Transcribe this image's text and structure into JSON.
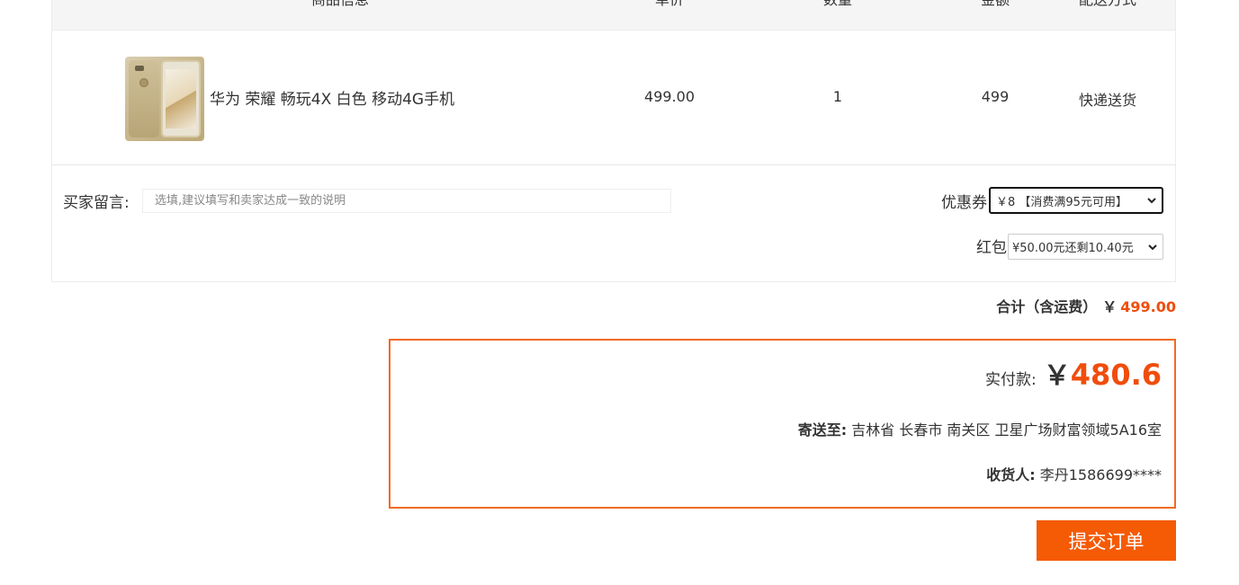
{
  "table_header": {
    "product_info": "商品信息",
    "unit_price": "单价",
    "quantity": "数量",
    "amount": "金额",
    "delivery": "配送方式"
  },
  "item": {
    "name": "华为 荣耀 畅玩4X 白色 移动4G手机",
    "unit_price": "499.00",
    "quantity": "1",
    "amount": "499",
    "delivery": "快递送货"
  },
  "buyer_message": {
    "label": "买家留言:",
    "placeholder": "选填,建议填写和卖家达成一致的说明"
  },
  "coupon": {
    "label": "优惠券",
    "selected": "￥8 【消费满95元可用】"
  },
  "red_packet": {
    "label": "红包",
    "selected": "¥50.00元还剩10.40元"
  },
  "total": {
    "label": "合计（含运费）",
    "currency": "￥",
    "amount": "499.00"
  },
  "payment": {
    "label": "实付款:",
    "currency": "￥",
    "amount": "480.6",
    "ship_to_label": "寄送至:",
    "ship_to": "吉林省 长春市 南关区 卫星广场财富领域5A16室",
    "consignee_label": "收货人:",
    "consignee": "李丹1586699****"
  },
  "submit_label": "提交订单",
  "colors": {
    "accent": "#f04d0d",
    "button": "#f55a05",
    "box_border": "#f06a25"
  }
}
